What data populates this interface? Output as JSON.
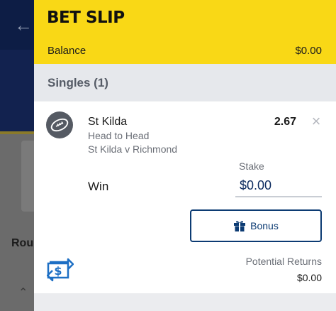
{
  "header": {
    "title": "BET SLIP",
    "balance_label": "Balance",
    "balance_value": "$0.00"
  },
  "singles": {
    "label": "Singles (1)"
  },
  "bet": {
    "selection": "St Kilda",
    "odds": "2.67",
    "market": "Head to Head",
    "event": "St Kilda v Richmond",
    "stake_label": "Stake",
    "win_label": "Win",
    "stake_value": "$0.00",
    "bonus_label": "Bonus",
    "returns_label": "Potential Returns",
    "returns_value": "$0.00",
    "sport_icon": "football-icon",
    "close_icon": "close-icon"
  },
  "background": {
    "partial_text": "Rour"
  },
  "colors": {
    "header_bg": "#f9d816",
    "accent_navy": "#0c3b73",
    "stake_text": "#0c2b5f"
  }
}
